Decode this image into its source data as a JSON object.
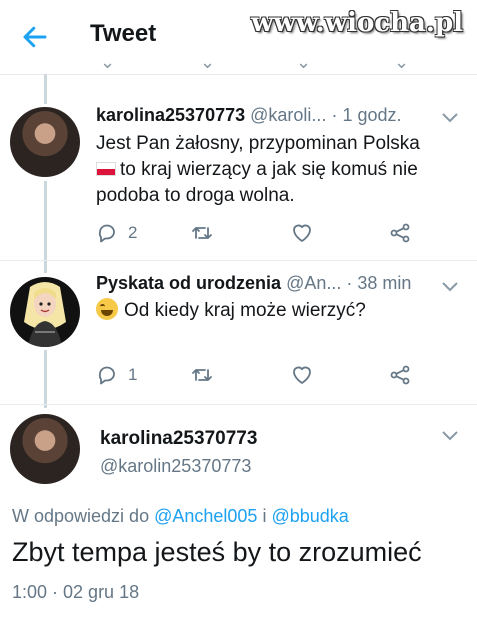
{
  "header": {
    "title": "Tweet",
    "watermark": "www.wiocha.pl"
  },
  "tweets": [
    {
      "name": "karolina25370773",
      "handle": "@karoli...",
      "time": "· 1 godz.",
      "text_a": "Jest Pan żałosny, przypominan Polska",
      "text_b": "to kraj wierzący a jak się komuś nie",
      "text_c": "podoba to droga wolna.",
      "replies": "2",
      "retweets": "",
      "likes": ""
    },
    {
      "name": "Pyskata od urodzenia",
      "handle": "@An...",
      "time": "· 38 min",
      "text_a": "Od kiedy kraj może wierzyć?",
      "replies": "1",
      "retweets": "",
      "likes": ""
    }
  ],
  "focus_tweet": {
    "name": "karolina25370773",
    "handle": "@karolin25370773",
    "reply_prefix": "W odpowiedzi do",
    "reply_user_1": "@Anchel005",
    "reply_joiner": "i",
    "reply_user_2": "@bbudka",
    "text": "Zbyt tempa jesteś by to zrozumieć",
    "timestamp": "1:00 · 02 gru 18"
  },
  "icons": {
    "back": "arrow-left-icon",
    "reply": "reply-bubble-icon",
    "retweet": "retweet-icon",
    "like": "heart-icon",
    "share": "share-icon",
    "more": "chevron-down-icon",
    "flag": "flag-poland-icon",
    "emoji": "tears-of-joy-emoji-icon"
  },
  "colors": {
    "accent": "#1da1f2",
    "text": "#14171a",
    "secondary": "#657786",
    "thread_line": "#ccd6dd"
  }
}
